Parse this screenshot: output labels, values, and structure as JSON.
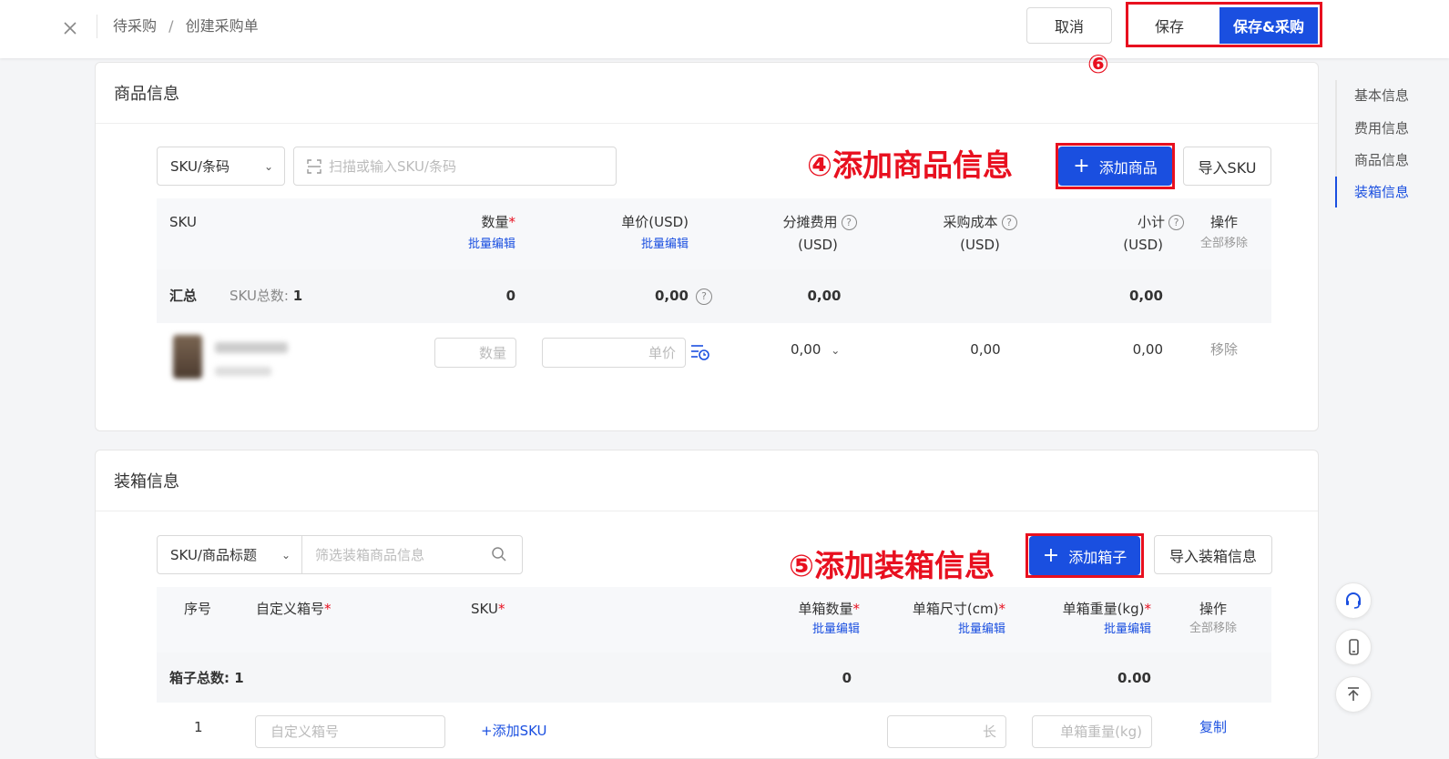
{
  "header": {
    "breadcrumb": [
      "待采购",
      "创建采购单"
    ],
    "breadcrumb_sep": "/",
    "cancel": "取消",
    "save": "保存",
    "save_purchase": "保存&采购"
  },
  "annotations": {
    "step4": "④添加商品信息",
    "step5": "⑤添加装箱信息",
    "step6": "⑥"
  },
  "right_nav": [
    "基本信息",
    "费用信息",
    "商品信息",
    "装箱信息"
  ],
  "right_nav_active": "装箱信息",
  "goods": {
    "title": "商品信息",
    "search_type": "SKU/条码",
    "search_placeholder": "扫描或输入SKU/条码",
    "add_button": "添加商品",
    "import_button": "导入SKU",
    "columns": {
      "sku": "SKU",
      "qty": "数量",
      "qty_batch": "批量编辑",
      "price": "单价(USD)",
      "price_batch": "批量编辑",
      "alloc": "分摊费用",
      "alloc_unit": "(USD)",
      "cost": "采购成本",
      "cost_unit": "(USD)",
      "subtotal": "小计",
      "subtotal_unit": "(USD)",
      "ops": "操作",
      "ops_remove_all": "全部移除"
    },
    "summary": {
      "label": "汇总",
      "sku_count_label": "SKU总数:",
      "sku_count": "1",
      "qty": "0",
      "price": "0,00",
      "alloc": "0,00",
      "subtotal": "0,00"
    },
    "row": {
      "qty_placeholder": "数量",
      "price_placeholder": "单价",
      "alloc": "0,00",
      "cost": "0,00",
      "subtotal": "0,00",
      "remove": "移除"
    }
  },
  "boxes": {
    "title": "装箱信息",
    "filter_type": "SKU/商品标题",
    "filter_placeholder": "筛选装箱商品信息",
    "add_button": "添加箱子",
    "import_button": "导入装箱信息",
    "columns": {
      "index": "序号",
      "box_no": "自定义箱号",
      "sku": "SKU",
      "box_qty": "单箱数量",
      "box_qty_batch": "批量编辑",
      "box_size": "单箱尺寸(cm)",
      "box_size_batch": "批量编辑",
      "box_weight": "单箱重量(kg)",
      "box_weight_batch": "批量编辑",
      "ops": "操作",
      "ops_remove_all": "全部移除"
    },
    "summary": {
      "label": "箱子总数: 1",
      "qty": "0",
      "weight": "0.00"
    },
    "row": {
      "index": "1",
      "box_no_placeholder": "自定义箱号",
      "add_sku": "+添加SKU",
      "length_placeholder": "长",
      "weight_placeholder": "单箱重量(kg)",
      "copy": "复制"
    }
  },
  "colors": {
    "primary": "#1a4fe0",
    "annotation_red": "#e8101f"
  }
}
